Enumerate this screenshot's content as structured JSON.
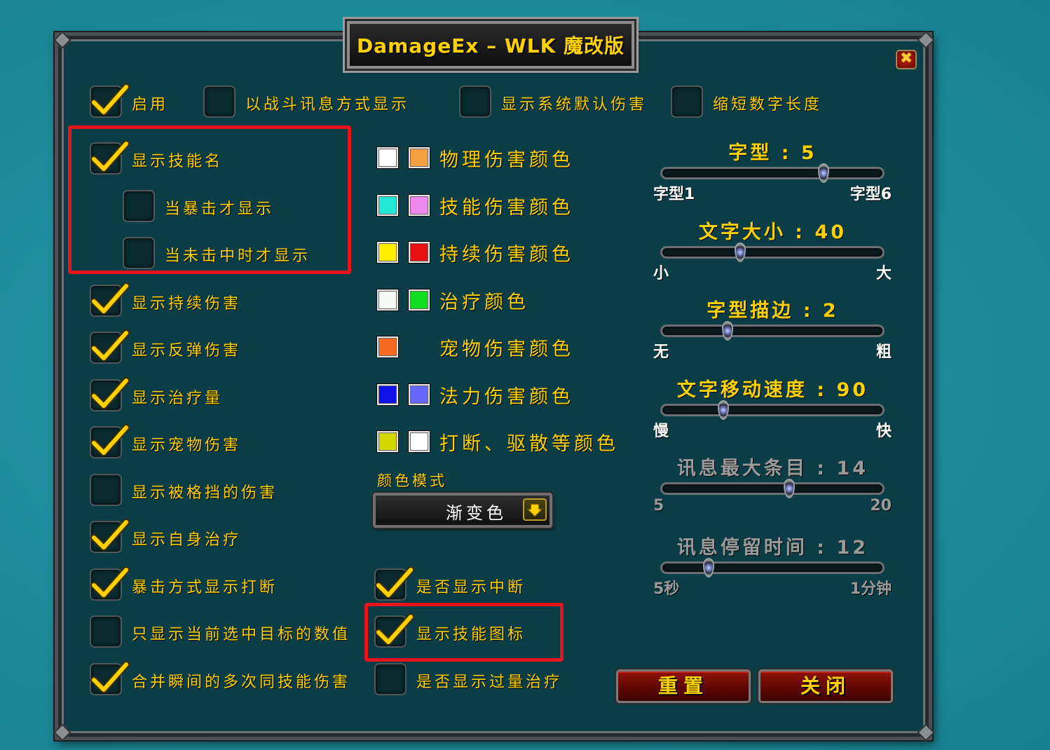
{
  "window": {
    "title": "DamageEx – WLK 魔改版",
    "close_symbol": "✖"
  },
  "top_options": [
    {
      "label": "启用",
      "checked": true
    },
    {
      "label": "以战斗讯息方式显示",
      "checked": false
    },
    {
      "label": "显示系统默认伤害",
      "checked": false
    },
    {
      "label": "缩短数字长度",
      "checked": false
    }
  ],
  "left_options": [
    {
      "label": "显示技能名",
      "checked": true
    },
    {
      "label": "当暴击才显示",
      "checked": false
    },
    {
      "label": "当未击中时才显示",
      "checked": false
    },
    {
      "label": "显示持续伤害",
      "checked": true
    },
    {
      "label": "显示反弹伤害",
      "checked": true
    },
    {
      "label": "显示治疗量",
      "checked": true
    },
    {
      "label": "显示宠物伤害",
      "checked": true
    },
    {
      "label": "显示被格挡的伤害",
      "checked": false
    },
    {
      "label": "显示自身治疗",
      "checked": true
    },
    {
      "label": "暴击方式显示打断",
      "checked": true
    },
    {
      "label": "只显示当前选中目标的数值",
      "checked": false
    },
    {
      "label": "合并瞬间的多次同技能伤害",
      "checked": true
    }
  ],
  "middle_options": [
    {
      "label": "是否显示中断",
      "checked": true
    },
    {
      "label": "显示技能图标",
      "checked": true
    },
    {
      "label": "是否显示过量治疗",
      "checked": false
    }
  ],
  "colors": [
    {
      "label": "物理伤害颜色",
      "swatches": [
        "#ffffff",
        "#f4a040"
      ]
    },
    {
      "label": "技能伤害颜色",
      "swatches": [
        "#22e8d8",
        "#ee88ee"
      ]
    },
    {
      "label": "持续伤害颜色",
      "swatches": [
        "#ffee00",
        "#e81010"
      ]
    },
    {
      "label": "治疗颜色",
      "swatches": [
        "#f4fbf4",
        "#10dd20"
      ]
    },
    {
      "label": "宠物伤害颜色",
      "swatches": [
        "#f86a22"
      ]
    },
    {
      "label": "法力伤害颜色",
      "swatches": [
        "#1010e8",
        "#6666ff"
      ]
    },
    {
      "label": "打断、驱散等颜色",
      "swatches": [
        "#d6d600",
        "#ffffff"
      ]
    }
  ],
  "color_mode": {
    "label": "颜色模式",
    "value": "渐变色"
  },
  "sliders": [
    {
      "name": "字型",
      "value_text": "5",
      "fraction": 0.74,
      "min_label": "字型1",
      "max_label": "字型6",
      "enabled": true
    },
    {
      "name": "文字大小",
      "value_text": "40",
      "fraction": 0.35,
      "min_label": "小",
      "max_label": "大",
      "enabled": true
    },
    {
      "name": "字型描边",
      "value_text": "2",
      "fraction": 0.29,
      "min_label": "无",
      "max_label": "粗",
      "enabled": true
    },
    {
      "name": "文字移动速度",
      "value_text": "90",
      "fraction": 0.27,
      "min_label": "慢",
      "max_label": "快",
      "enabled": true
    },
    {
      "name": "讯息最大条目",
      "value_text": "14",
      "fraction": 0.58,
      "min_label": "5",
      "max_label": "20",
      "enabled": false
    },
    {
      "name": "讯息停留时间",
      "value_text": "12",
      "fraction": 0.2,
      "min_label": "5秒",
      "max_label": "1分钟",
      "enabled": false
    }
  ],
  "buttons": {
    "reset": "重置",
    "close": "关闭"
  },
  "accent_colors": {
    "gold": "#ffd100",
    "highlight_red": "#e8141c",
    "panel": "#0b3d47"
  }
}
